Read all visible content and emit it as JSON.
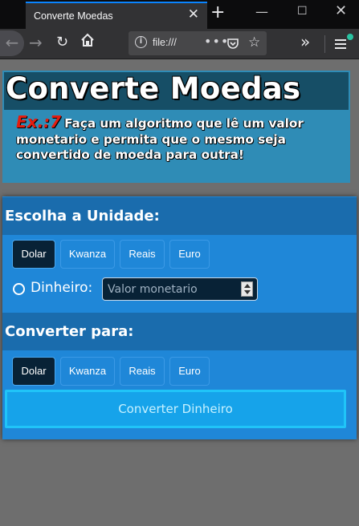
{
  "browser": {
    "tab_title": "Converte Moedas",
    "tab_close": "✕",
    "new_tab": "+",
    "url": "file:///",
    "url_dots": "•••"
  },
  "page": {
    "title": "Converte Moedas",
    "exercise_label": "Ex.:7",
    "description": "Faça um algoritmo que lê um valor monetario e permita que o mesmo seja convertido de moeda para outra!"
  },
  "source_section": {
    "heading": "Escolha a Unidade:",
    "options": [
      "Dolar",
      "Kwanza",
      "Reais",
      "Euro"
    ],
    "selected": "Dolar",
    "money_label": "Dinheiro:",
    "money_value": "",
    "money_placeholder": "Valor monetario"
  },
  "target_section": {
    "heading": "Converter para:",
    "options": [
      "Dolar",
      "Kwanza",
      "Reais",
      "Euro"
    ],
    "selected": "Dolar"
  },
  "convert_button_label": "Converter Dinheiro",
  "colors": {
    "header_band": "#164e66",
    "header_box": "#2f8cb6",
    "panel": "#1f87d8",
    "section_head": "#1a6cad",
    "selected_button": "#082236",
    "convert_button": "#16a3ea",
    "exercise_label": "#e51c0f"
  },
  "icons": {
    "back": "arrow-left-icon",
    "forward": "arrow-right-icon",
    "reload": "reload-icon",
    "home": "home-icon",
    "info": "info-icon",
    "pocket": "pocket-icon",
    "bookmark": "star-icon",
    "overflow": "chevrons-right-icon",
    "menu": "hamburger-menu-icon"
  }
}
